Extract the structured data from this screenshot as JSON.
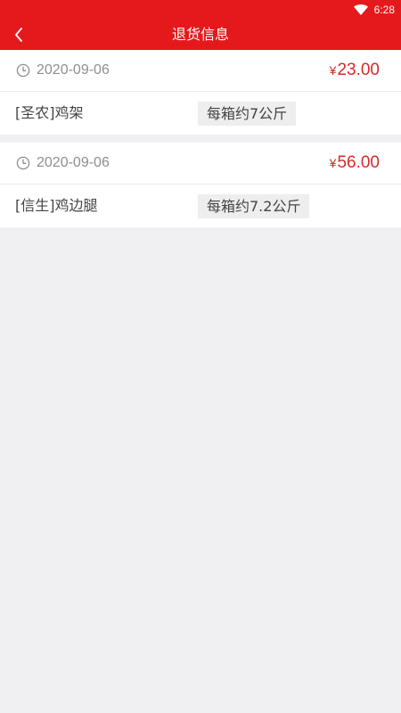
{
  "status_bar": {
    "time": "6:28",
    "wifi_icon": "wifi-icon"
  },
  "header": {
    "title": "退货信息",
    "back_icon": "chevron-left-icon",
    "background": "#e5191c"
  },
  "orders": [
    {
      "date": "2020-09-06",
      "currency": "¥",
      "amount": "23.00",
      "product": "[圣农]鸡架",
      "spec": "每箱约7公斤"
    },
    {
      "date": "2020-09-06",
      "currency": "¥",
      "amount": "56.00",
      "product": "[信生]鸡边腿",
      "spec": "每箱约7.2公斤"
    }
  ],
  "colors": {
    "accent": "#e5191c",
    "price": "#d7282a",
    "page_background": "#f0eff2",
    "muted_text": "#8e8e93"
  }
}
